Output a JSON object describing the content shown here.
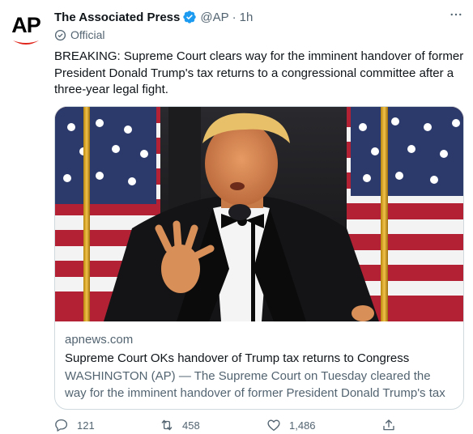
{
  "tweet": {
    "avatar_text": "AP",
    "author_name": "The Associated Press",
    "handle": "@AP",
    "separator": "·",
    "time": "1h",
    "more_icon": "more-dots-icon",
    "official_label": "Official",
    "text": "BREAKING: Supreme Court clears way for the imminent handover of former President Donald Trump's tax returns to a congressional committee after a three-year legal fight."
  },
  "card": {
    "domain": "apnews.com",
    "title": "Supreme Court OKs handover of Trump tax returns to Congress",
    "description": "WASHINGTON (AP) — The Supreme Court on Tuesday cleared the way for the imminent handover of former President Donald Trump's tax …"
  },
  "actions": {
    "reply_count": "121",
    "retweet_count": "458",
    "like_count": "1,486"
  },
  "colors": {
    "text_primary": "#0f1419",
    "text_secondary": "#536471",
    "verified_blue": "#1d9bf0",
    "ap_red": "#e0241b",
    "border": "#cfd9de"
  }
}
